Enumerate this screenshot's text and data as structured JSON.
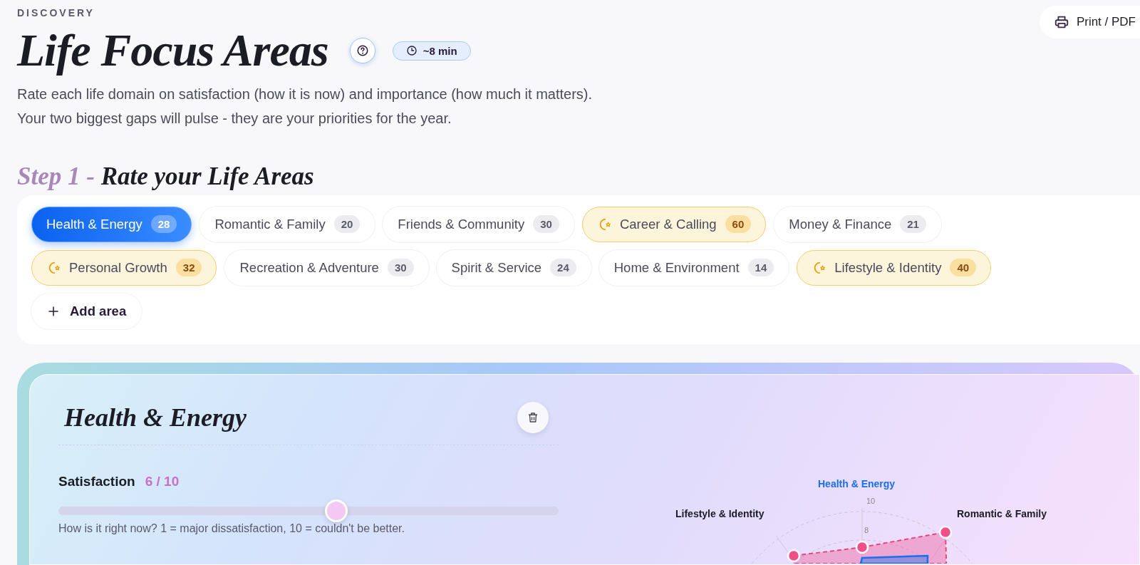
{
  "header": {
    "eyebrow": "DISCOVERY",
    "title": "Life Focus Areas",
    "duration": "~8 min",
    "description": [
      "Rate each life domain on satisfaction (how it is now) and importance (how much it matters).",
      "Your two biggest gaps will pulse - they are your priorities for the year."
    ],
    "print_button": "Print / PDF"
  },
  "step": {
    "number": "Step 1",
    "separator": "-",
    "title": "Rate your Life Areas"
  },
  "areas": [
    {
      "label": "Health & Energy",
      "count": "28",
      "selected": true,
      "priority": false
    },
    {
      "label": "Romantic & Family",
      "count": "20",
      "selected": false,
      "priority": false
    },
    {
      "label": "Friends & Community",
      "count": "30",
      "selected": false,
      "priority": false
    },
    {
      "label": "Career & Calling",
      "count": "60",
      "selected": false,
      "priority": true
    },
    {
      "label": "Money & Finance",
      "count": "21",
      "selected": false,
      "priority": false
    },
    {
      "label": "Personal Growth",
      "count": "32",
      "selected": false,
      "priority": true
    },
    {
      "label": "Recreation & Adventure",
      "count": "30",
      "selected": false,
      "priority": false
    },
    {
      "label": "Spirit & Service",
      "count": "24",
      "selected": false,
      "priority": false
    },
    {
      "label": "Home & Environment",
      "count": "14",
      "selected": false,
      "priority": false
    },
    {
      "label": "Lifestyle & Identity",
      "count": "40",
      "selected": false,
      "priority": true
    }
  ],
  "add_area": "Add area",
  "detail": {
    "title": "Health & Energy",
    "satisfaction": {
      "label": "Satisfaction",
      "reading": "6 / 10",
      "level": 0.555,
      "hint": "How is it right now? 1 = major dissatisfaction, 10 = couldn't be better."
    },
    "radar": {
      "axis_labels": [
        {
          "text": "Health & Energy",
          "selected": true
        },
        {
          "text": "Lifestyle & Identity",
          "selected": false
        },
        {
          "text": "Romantic & Family",
          "selected": false
        }
      ],
      "tick_labels": [
        "10",
        "8"
      ]
    }
  }
}
